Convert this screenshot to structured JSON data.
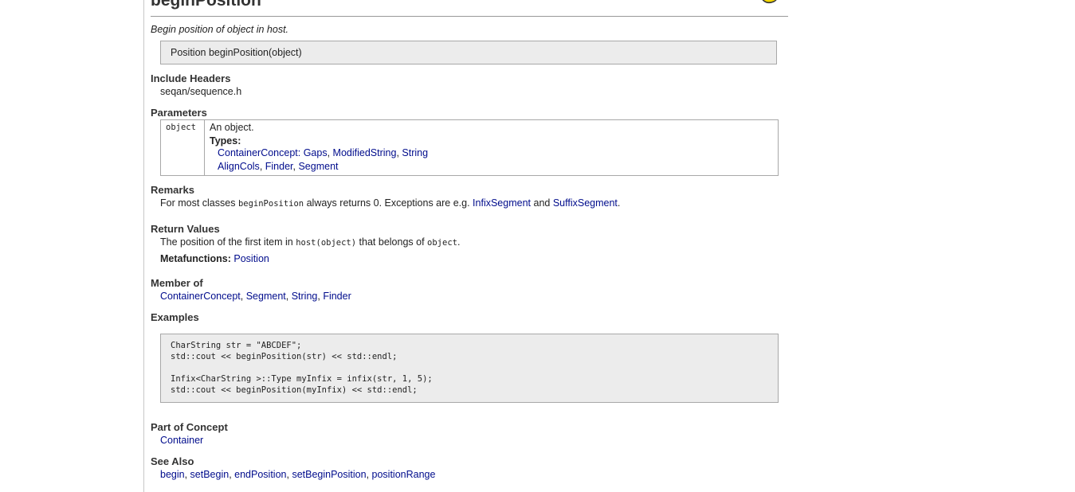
{
  "page": {
    "title": "beginPosition",
    "summary": "Begin position of object in host.",
    "signature": "Position beginPosition(object)"
  },
  "include_headers": {
    "heading": "Include Headers",
    "value": "seqan/sequence.h"
  },
  "parameters": {
    "heading": "Parameters",
    "rows": [
      {
        "name": "object",
        "description": "An object.",
        "types_label": "Types:",
        "types_line1": [
          "ContainerConcept: Gaps",
          "ModifiedString",
          "String"
        ],
        "types_line2": [
          "AlignCols",
          "Finder",
          "Segment"
        ]
      }
    ]
  },
  "remarks": {
    "heading": "Remarks",
    "text_before": "For most classes ",
    "code": "beginPosition",
    "text_middle": " always returns 0. Exceptions are e.g. ",
    "link1": "InfixSegment",
    "text_and": " and ",
    "link2": "SuffixSegment",
    "text_end": "."
  },
  "return_values": {
    "heading": "Return Values",
    "text_before": "The position of the first item in ",
    "code1": "host(object)",
    "text_middle": " that belongs of ",
    "code2": "object",
    "text_end": ".",
    "metafunctions_label": "Metafunctions:",
    "metafunctions_link": "Position"
  },
  "member_of": {
    "heading": "Member of",
    "links": [
      "ContainerConcept",
      "Segment",
      "String",
      "Finder"
    ]
  },
  "examples": {
    "heading": "Examples",
    "lines": [
      "CharString str = \"ABCDEF\";",
      "std::cout << beginPosition(str) << std::endl;",
      "",
      "Infix<CharString >::Type myInfix = infix(str, 1, 5);",
      "std::cout << beginPosition(myInfix) << std::endl;"
    ]
  },
  "part_of_concept": {
    "heading": "Part of Concept",
    "links": [
      "Container"
    ]
  },
  "see_also": {
    "heading": "See Also",
    "links": [
      "begin",
      "setBegin",
      "endPosition",
      "setBeginPosition",
      "positionRange"
    ]
  },
  "colors": {
    "link": "#000c8c",
    "box_background": "#ececec",
    "box_border": "#a8a8a8",
    "logo_yellow": "#f5d800"
  }
}
